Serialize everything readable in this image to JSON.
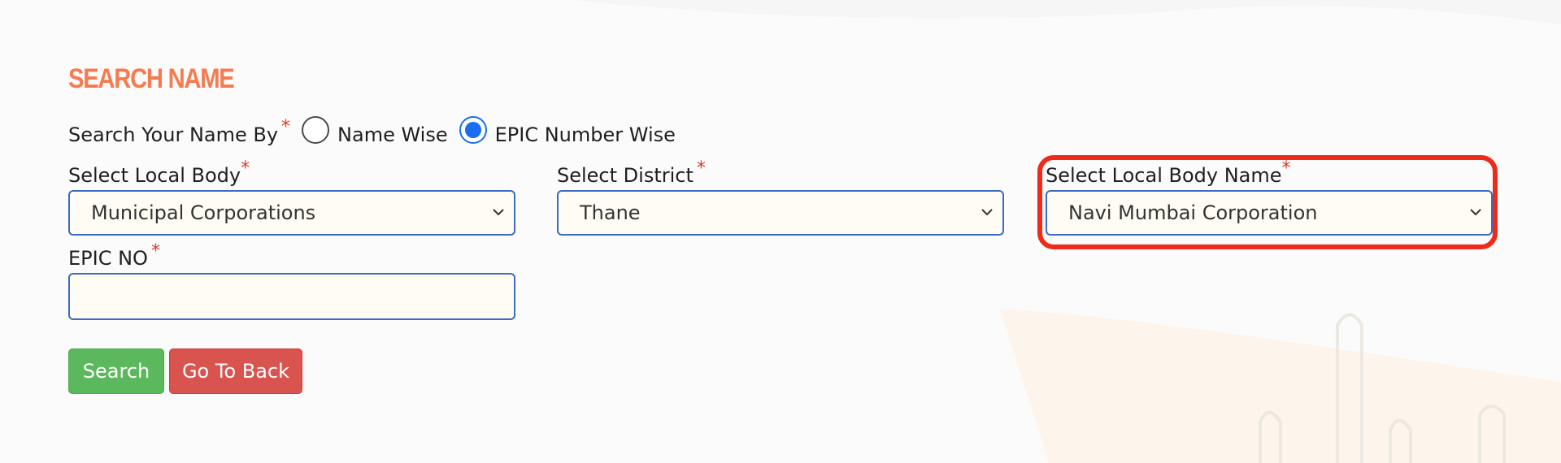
{
  "title": "SEARCH NAME",
  "search_by": {
    "label": "Search Your Name By",
    "required_mark": "*",
    "options": [
      {
        "label": "Name Wise",
        "selected": false
      },
      {
        "label": "EPIC Number Wise",
        "selected": true
      }
    ]
  },
  "fields": {
    "local_body": {
      "label": "Select Local Body",
      "required_mark": "*",
      "value": "Municipal Corporations"
    },
    "district": {
      "label": "Select District",
      "required_mark": "*",
      "value": "Thane"
    },
    "local_body_name": {
      "label": "Select Local Body Name",
      "required_mark": "*",
      "value": "Navi Mumbai Corporation"
    },
    "epic_no": {
      "label": "EPIC NO",
      "required_mark": "*",
      "value": ""
    }
  },
  "buttons": {
    "search": "Search",
    "back": "Go To Back"
  },
  "colors": {
    "title": "#f47c50",
    "required": "#e03a22",
    "input_border": "#3b6cc2",
    "input_bg": "#fffcf4",
    "radio_selected": "#1a6cf0",
    "search_button": "#5cb85c",
    "back_button": "#d9534f",
    "highlight": "#ee2a1b"
  }
}
